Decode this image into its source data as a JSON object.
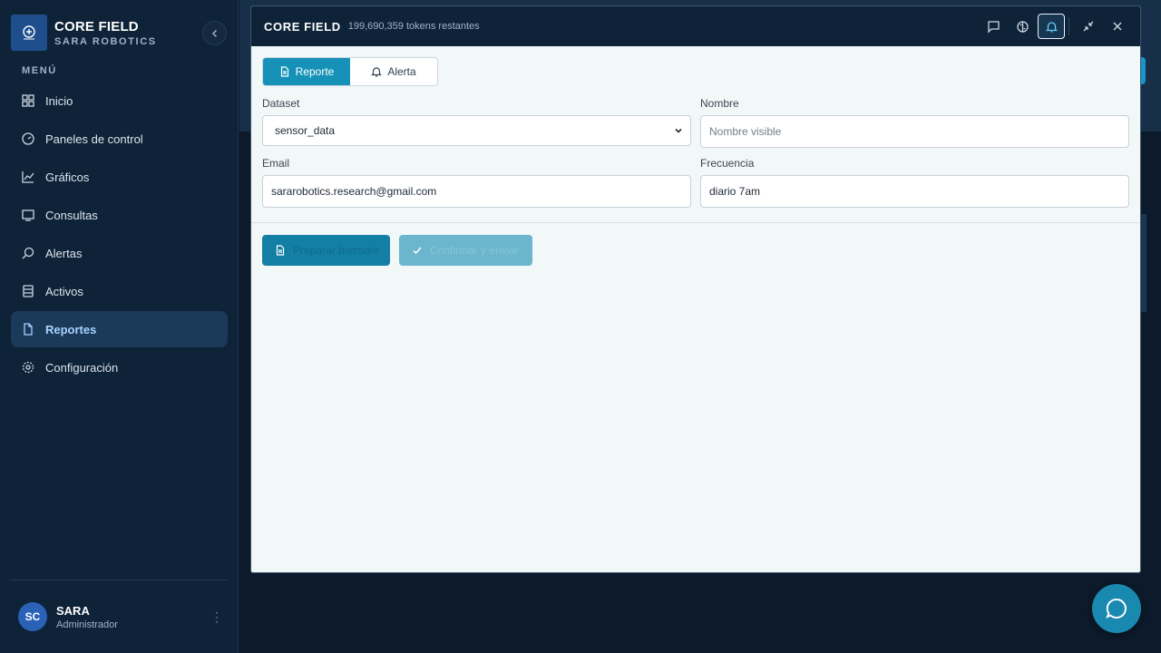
{
  "brand": {
    "title": "CORE FIELD",
    "subtitle": "SARA ROBOTICS"
  },
  "menu_label": "MENÚ",
  "nav": [
    {
      "label": "Inicio",
      "icon": "grid-icon",
      "active": false
    },
    {
      "label": "Paneles de control",
      "icon": "gauge-icon",
      "active": false
    },
    {
      "label": "Gráficos",
      "icon": "chart-line-icon",
      "active": false
    },
    {
      "label": "Consultas",
      "icon": "sql-icon",
      "active": false
    },
    {
      "label": "Alertas",
      "icon": "search-alert-icon",
      "active": false
    },
    {
      "label": "Activos",
      "icon": "database-icon",
      "active": false
    },
    {
      "label": "Reportes",
      "icon": "file-icon",
      "active": true
    },
    {
      "label": "Configuración",
      "icon": "gear-icon",
      "active": false
    }
  ],
  "user": {
    "initials": "SC",
    "name": "SARA",
    "role": "Administrador"
  },
  "modal": {
    "title": "CORE FIELD",
    "tokens": "199,690,359 tokens restantes",
    "tabs": {
      "report": "Reporte",
      "alert": "Alerta"
    },
    "dataset": {
      "label": "Dataset",
      "value": "sensor_data"
    },
    "nombre": {
      "label": "Nombre",
      "placeholder": "Nombre visible"
    },
    "email": {
      "label": "Email",
      "value": "sararobotics.research@gmail.com"
    },
    "frecuencia": {
      "label": "Frecuencia",
      "value": "diario 7am"
    },
    "buttons": {
      "preview": "Preparar borrador",
      "confirm": "Confirmar y enviar"
    }
  },
  "colors": {
    "accent": "#1692b8",
    "sidebar": "#0f2338",
    "active_nav": "#1b3a5a"
  }
}
